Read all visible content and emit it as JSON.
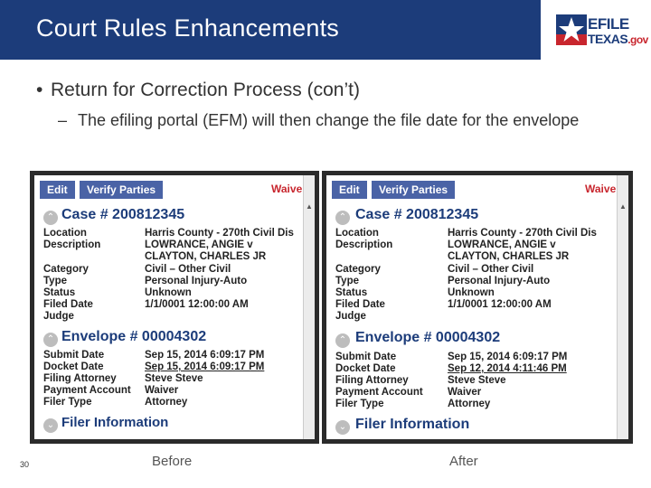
{
  "header": {
    "title": "Court Rules Enhancements"
  },
  "logo": {
    "top": "EFILE",
    "bottom": "TEXAS",
    "suffix": ".gov",
    "brand_color": "#1c3c7a",
    "accent_color": "#c8262e"
  },
  "bullets": {
    "level1": "Return for Correction Process (con’t)",
    "level2": "The efiling portal (EFM) will then change the file date for the envelope"
  },
  "screenshots": {
    "before": {
      "buttons": [
        "Edit",
        "Verify Parties"
      ],
      "waiver": "Waiver",
      "case_title": "Case # 200812345",
      "case_fields": [
        {
          "label": "Location",
          "value": "Harris County - 270th Civil Dis"
        },
        {
          "label": "Description",
          "value": "LOWRANCE, ANGIE v"
        },
        {
          "label": "",
          "value": "CLAYTON, CHARLES JR"
        },
        {
          "label": "Category",
          "value": "Civil – Other Civil"
        },
        {
          "label": "Type",
          "value": "Personal Injury-Auto"
        },
        {
          "label": "Status",
          "value": "Unknown"
        },
        {
          "label": "Filed Date",
          "value": "1/1/0001 12:00:00 AM"
        },
        {
          "label": "Judge",
          "value": ""
        }
      ],
      "envelope_title": "Envelope # 00004302",
      "envelope_fields": [
        {
          "label": "Submit Date",
          "value": "Sep 15, 2014 6:09:17 PM"
        },
        {
          "label": "Docket Date",
          "value": "Sep 15, 2014 6:09:17 PM"
        },
        {
          "label": "Filing Attorney",
          "value": "Steve Steve"
        },
        {
          "label": "Payment Account",
          "value": "Waiver"
        },
        {
          "label": "Filer Type",
          "value": "Attorney"
        }
      ],
      "filer_title": "Filer Information",
      "caption": "Before"
    },
    "after": {
      "buttons": [
        "Edit",
        "Verify Parties"
      ],
      "waiver": "Waiver",
      "case_title": "Case # 200812345",
      "case_fields": [
        {
          "label": "Location",
          "value": "Harris County - 270th Civil Dis"
        },
        {
          "label": "Description",
          "value": "LOWRANCE, ANGIE v"
        },
        {
          "label": "",
          "value": "CLAYTON, CHARLES JR"
        },
        {
          "label": "Category",
          "value": "Civil – Other Civil"
        },
        {
          "label": "Type",
          "value": "Personal Injury-Auto"
        },
        {
          "label": "Status",
          "value": "Unknown"
        },
        {
          "label": "Filed Date",
          "value": "1/1/0001 12:00:00 AM"
        },
        {
          "label": "Judge",
          "value": ""
        }
      ],
      "envelope_title": "Envelope # 00004302",
      "envelope_fields": [
        {
          "label": "Submit Date",
          "value": "Sep 15, 2014 6:09:17 PM"
        },
        {
          "label": "Docket Date",
          "value": "Sep 12, 2014 4:11:46 PM"
        },
        {
          "label": "Filing Attorney",
          "value": "Steve Steve"
        },
        {
          "label": "Payment Account",
          "value": "Waiver"
        },
        {
          "label": "Filer Type",
          "value": "Attorney"
        }
      ],
      "filer_title": "Filer Information",
      "caption": "After"
    }
  },
  "slide_number": "30"
}
